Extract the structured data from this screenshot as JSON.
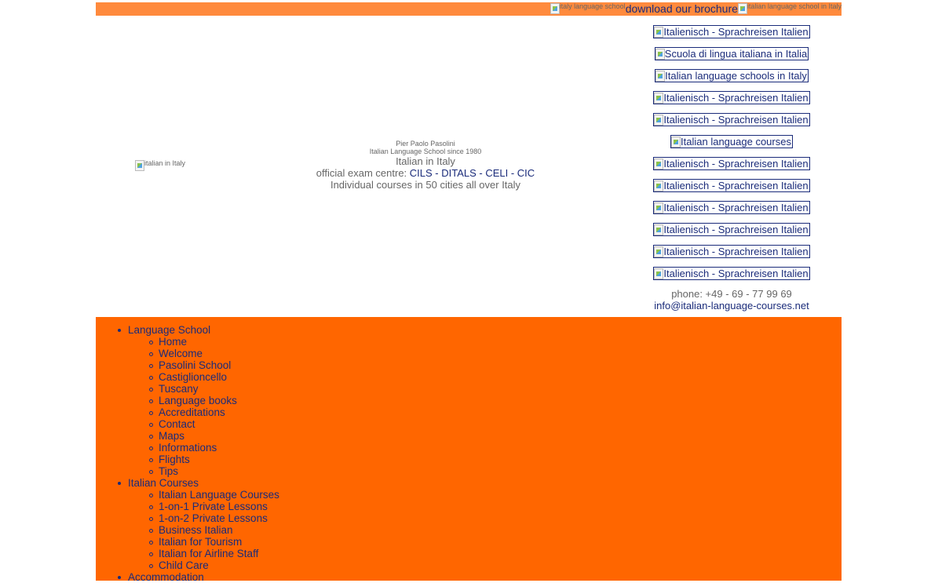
{
  "topbar": {
    "left_img_alt": "italy language school",
    "brochure_link": "download our brochure",
    "right_img_alt": "italian language school in Italy"
  },
  "header": {
    "logo_alt": "italian in Italy",
    "line1": "Pier Paolo Pasolini",
    "line2": "Italian Language School since 1980",
    "line3": "Italian in Italy",
    "line4_prefix": "official exam centre: ",
    "line4_link": "CILS - DITALS - CELI - CIC",
    "line5": "Individual courses in 50 cities all over Italy"
  },
  "right_links": [
    "Italienisch - Sprachreisen Italien",
    "Scuola di lingua italiana in Italia",
    "Italian language schools in Italy",
    "Italienisch - Sprachreisen Italien",
    "Italienisch - Sprachreisen Italien",
    "Italian language courses",
    "Italienisch - Sprachreisen Italien",
    "Italienisch - Sprachreisen Italien",
    "Italienisch - Sprachreisen Italien",
    "Italienisch - Sprachreisen Italien",
    "Italienisch - Sprachreisen Italien",
    "Italienisch - Sprachreisen Italien"
  ],
  "contact": {
    "phone": "phone: +49 - 69 - 77 99 69",
    "email": "info@italian-language-courses.net"
  },
  "nav": {
    "sections": [
      {
        "label": "Language School",
        "items": [
          "Home",
          "Welcome",
          "Pasolini School",
          "Castiglioncello",
          "Tuscany",
          "Language books",
          "Accreditations",
          "Contact",
          "Maps",
          "Informations",
          "Flights",
          "Tips"
        ]
      },
      {
        "label": "Italian Courses",
        "items": [
          "Italian Language Courses",
          "1-on-1 Private Lessons",
          "1-on-2 Private Lessons",
          "Business Italian",
          "Italian for Tourism",
          "Italian for Airline Staff",
          "Child Care"
        ]
      },
      {
        "label": "Accommodation",
        "items": []
      }
    ]
  },
  "colors": {
    "topbar": "#ff8a3d",
    "nav_bg": "#ff6600",
    "link": "#1a2b7a"
  }
}
